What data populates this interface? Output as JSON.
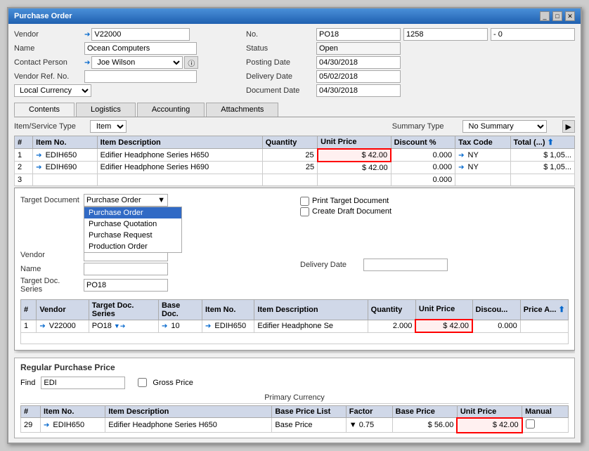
{
  "window": {
    "title": "Purchase Order"
  },
  "vendor": {
    "label": "Vendor",
    "value": "V22000"
  },
  "name": {
    "label": "Name",
    "value": "Ocean Computers"
  },
  "contact": {
    "label": "Contact Person",
    "value": "Joe Wilson"
  },
  "vendor_ref": {
    "label": "Vendor Ref. No.",
    "value": ""
  },
  "currency": {
    "label": "Local Currency"
  },
  "no": {
    "label": "No.",
    "value": "PO18"
  },
  "no2": {
    "value": "1258"
  },
  "no3": {
    "value": "- 0"
  },
  "status": {
    "label": "Status",
    "value": "Open"
  },
  "posting_date": {
    "label": "Posting Date",
    "value": "04/30/2018"
  },
  "delivery_date": {
    "label": "Delivery Date",
    "value": "05/02/2018"
  },
  "document_date": {
    "label": "Document Date",
    "value": "04/30/2018"
  },
  "tabs": [
    "Contents",
    "Logistics",
    "Accounting",
    "Attachments"
  ],
  "active_tab": "Contents",
  "item_type": {
    "label": "Item/Service Type",
    "value": "Item"
  },
  "summary_type": {
    "label": "Summary Type",
    "value": "No Summary"
  },
  "table_headers": [
    "#",
    "Item No.",
    "Item Description",
    "Quantity",
    "Unit Price",
    "Discount %",
    "Tax Code",
    "Total (...)"
  ],
  "table_rows": [
    {
      "num": "1",
      "item_no": "EDIH650",
      "description": "Edifier Headphone Series H650",
      "quantity": "25",
      "unit_price": "$ 42.00",
      "discount": "0.000",
      "tax_code": "NY",
      "total": "$ 1,05..."
    },
    {
      "num": "2",
      "item_no": "EDIH690",
      "description": "Edifier Headphone Series H690",
      "quantity": "25",
      "unit_price": "$ 42.00",
      "discount": "0.000",
      "tax_code": "NY",
      "total": "$ 1,05..."
    },
    {
      "num": "3",
      "item_no": "",
      "description": "",
      "quantity": "",
      "unit_price": "",
      "discount": "0.000",
      "tax_code": "",
      "total": ""
    }
  ],
  "popup": {
    "target_doc_label": "Target Document",
    "target_doc_value": "Purchase Order",
    "dropdown_options": [
      "Purchase Order",
      "Purchase Quotation",
      "Purchase Request",
      "Production Order"
    ],
    "selected_option": "Purchase Order",
    "vendor_label": "Vendor",
    "vendor_value": "",
    "name_label": "Name",
    "name_value": "",
    "target_series_label": "Target Doc. Series",
    "target_series_value": "PO18",
    "print_label": "Print Target Document",
    "create_label": "Create Draft Document",
    "delivery_date_label": "Delivery Date",
    "delivery_date_value": "",
    "inner_headers": [
      "#",
      "Vendor",
      "Target Doc. Series",
      "Base Doc.",
      "Item No.",
      "Item Description",
      "Quantity",
      "Unit Price",
      "Discou...",
      "Price A..."
    ],
    "inner_rows": [
      {
        "num": "1",
        "vendor": "V22000",
        "target_series": "PO18",
        "base_doc": "10",
        "item_no": "EDIH650",
        "item_desc": "Edifier Headphone Se",
        "quantity": "2.000",
        "unit_price": "$ 42.00",
        "discount": "0.000"
      }
    ]
  },
  "price_section": {
    "title": "Regular Purchase Price",
    "find_label": "Find",
    "find_value": "EDI",
    "gross_price_label": "Gross Price",
    "primary_currency": "Primary Currency",
    "headers": [
      "#",
      "Item No.",
      "Item Description",
      "Base Price List",
      "Factor",
      "Base Price",
      "Unit Price",
      "Manual"
    ],
    "rows": [
      {
        "num": "29",
        "item_no": "EDIH650",
        "description": "Edifier Headphone Series H650",
        "base_price_list": "Base Price",
        "factor": "▼ 0.75",
        "base_price": "$ 56.00",
        "unit_price": "$ 42.00",
        "manual": ""
      }
    ]
  }
}
